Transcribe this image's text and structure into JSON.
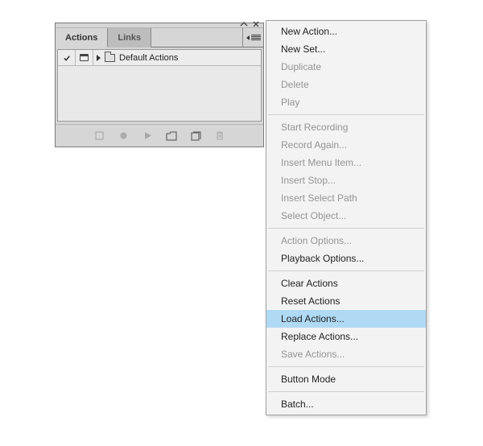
{
  "panel": {
    "tabs": [
      {
        "label": "Actions",
        "active": true
      },
      {
        "label": "Links",
        "active": false
      }
    ],
    "rows": [
      {
        "checked": true,
        "hasDialog": true,
        "label": "Default Actions"
      }
    ],
    "footerIcons": [
      {
        "name": "stop-icon",
        "disabled": true
      },
      {
        "name": "record-icon",
        "disabled": true
      },
      {
        "name": "play-icon",
        "disabled": true
      },
      {
        "name": "new-set-icon",
        "disabled": false
      },
      {
        "name": "new-action-icon",
        "disabled": false
      },
      {
        "name": "trash-icon",
        "disabled": true
      }
    ]
  },
  "menu": {
    "groups": [
      [
        {
          "label": "New Action...",
          "state": "enabled"
        },
        {
          "label": "New Set...",
          "state": "enabled"
        },
        {
          "label": "Duplicate",
          "state": "disabled"
        },
        {
          "label": "Delete",
          "state": "disabled"
        },
        {
          "label": "Play",
          "state": "disabled"
        }
      ],
      [
        {
          "label": "Start Recording",
          "state": "disabled"
        },
        {
          "label": "Record Again...",
          "state": "disabled"
        },
        {
          "label": "Insert Menu Item...",
          "state": "disabled"
        },
        {
          "label": "Insert Stop...",
          "state": "disabled"
        },
        {
          "label": "Insert Select Path",
          "state": "disabled"
        },
        {
          "label": "Select Object...",
          "state": "disabled"
        }
      ],
      [
        {
          "label": "Action Options...",
          "state": "disabled"
        },
        {
          "label": "Playback Options...",
          "state": "enabled"
        }
      ],
      [
        {
          "label": "Clear Actions",
          "state": "enabled"
        },
        {
          "label": "Reset Actions",
          "state": "enabled"
        },
        {
          "label": "Load Actions...",
          "state": "selected"
        },
        {
          "label": "Replace Actions...",
          "state": "enabled"
        },
        {
          "label": "Save Actions...",
          "state": "disabled"
        }
      ],
      [
        {
          "label": "Button Mode",
          "state": "enabled"
        }
      ],
      [
        {
          "label": "Batch...",
          "state": "enabled"
        }
      ]
    ]
  }
}
